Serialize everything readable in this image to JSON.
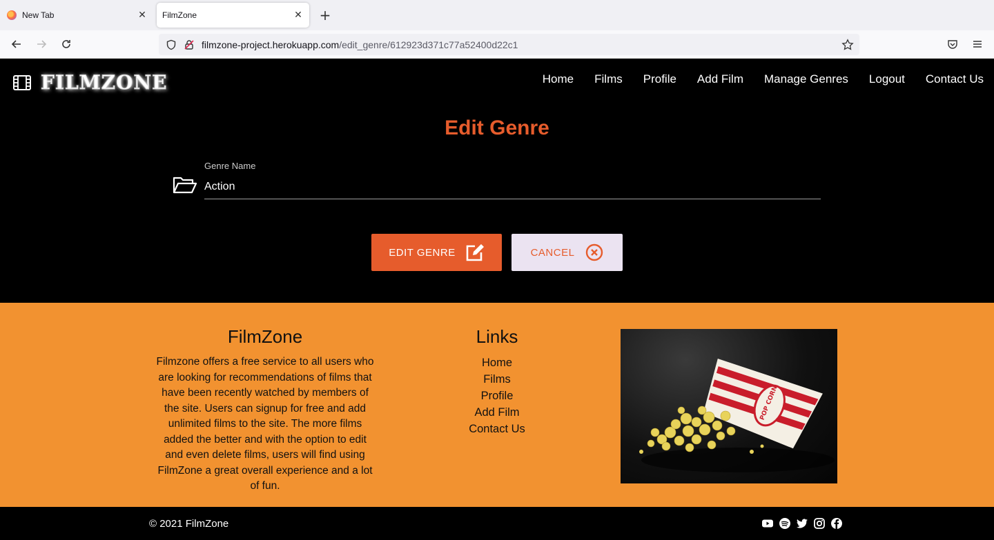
{
  "browser": {
    "tabs": [
      {
        "title": "New Tab",
        "active": false
      },
      {
        "title": "FilmZone",
        "active": true
      }
    ],
    "url_domain": "filmzone-project.herokuapp.com",
    "url_path": "/edit_genre/612923d371c77a52400d22c1"
  },
  "header": {
    "logo_text": "FILMZONE",
    "nav": [
      "Home",
      "Films",
      "Profile",
      "Add Film",
      "Manage Genres",
      "Logout",
      "Contact Us"
    ]
  },
  "form": {
    "title": "Edit Genre",
    "field_label": "Genre Name",
    "field_value": "Action",
    "submit_label": "EDIT GENRE",
    "cancel_label": "CANCEL"
  },
  "footer": {
    "about_title": "FilmZone",
    "about_text": "Filmzone offers a free service to all users who are looking for recommendations of films that have been recently watched by members of the site. Users can signup for free and add unlimited films to the site. The more films added the better and with the option to edit and even delete films, users will find using FilmZone a great overall experience and a lot of fun.",
    "links_title": "Links",
    "links": [
      "Home",
      "Films",
      "Profile",
      "Add Film",
      "Contact Us"
    ],
    "image_subject": "popcorn-box-image",
    "popcorn_label": "POP CORN",
    "copyright": "© 2021 FilmZone",
    "socials": [
      "youtube-icon",
      "spotify-icon",
      "twitter-icon",
      "instagram-icon",
      "facebook-icon"
    ]
  },
  "colors": {
    "accent": "#e65c2c",
    "footer_bg": "#f29230",
    "cancel_bg": "#ebe3f1"
  }
}
